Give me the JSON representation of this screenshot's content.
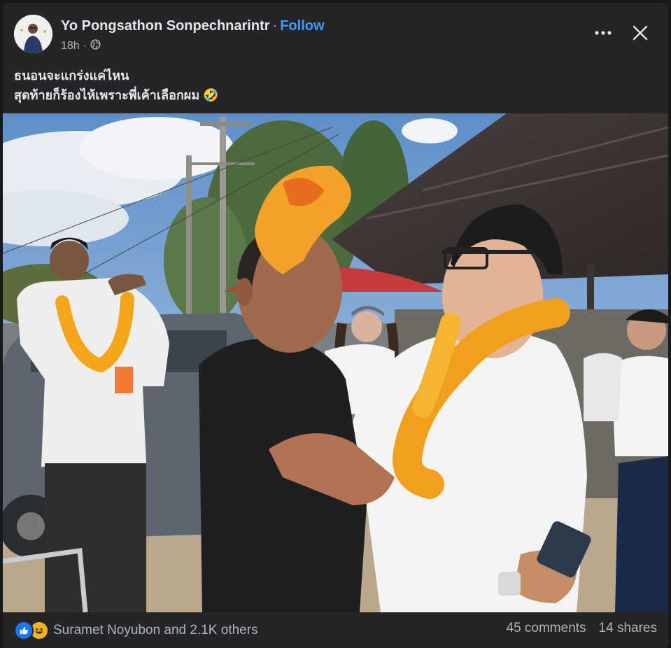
{
  "post": {
    "author": "Yo Pongsathon Sonpechnarintr",
    "separator": "·",
    "follow_label": "Follow",
    "time": "18h",
    "caption_line1": "ธนอนจะแกร่งแค่ไหน",
    "caption_line2": "สุดท้ายก็ร้องไห้เพราะพี่เค้าเลือกผม 🤣"
  },
  "footer": {
    "reaction_names": "Suramet Noyubon and 2.1K others",
    "comments": "45 comments",
    "shares": "14 shares"
  },
  "colors": {
    "background": "#18191a",
    "card": "#242526",
    "accent": "#4599ff",
    "secondary_text": "#b0b3b8",
    "like_blue": "#1877f2",
    "haha_yellow": "#f7b125"
  },
  "icons": [
    "globe-icon",
    "more-icon",
    "close-icon",
    "like-reaction-icon",
    "haha-reaction-icon"
  ]
}
